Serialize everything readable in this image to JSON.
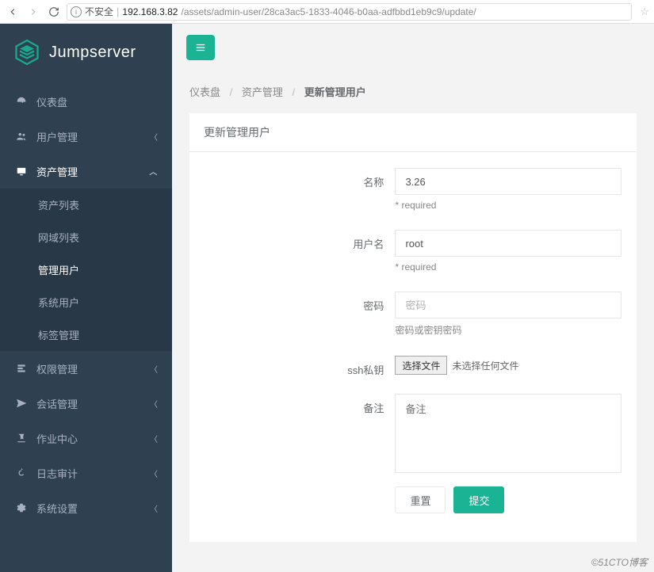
{
  "browser": {
    "insecure_label": "不安全",
    "host": "192.168.3.82",
    "path": "/assets/admin-user/28ca3ac5-1833-4046-b0aa-adfbbd1eb9c9/update/"
  },
  "brand": {
    "name": "Jumpserver"
  },
  "sidebar": {
    "items": [
      {
        "label": "仪表盘",
        "icon": "dashboard-icon",
        "expandable": false
      },
      {
        "label": "用户管理",
        "icon": "users-icon",
        "expandable": true
      },
      {
        "label": "资产管理",
        "icon": "assets-icon",
        "expandable": true,
        "open": true,
        "children": [
          {
            "label": "资产列表"
          },
          {
            "label": "网域列表"
          },
          {
            "label": "管理用户",
            "active": true
          },
          {
            "label": "系统用户"
          },
          {
            "label": "标签管理"
          }
        ]
      },
      {
        "label": "权限管理",
        "icon": "perms-icon",
        "expandable": true
      },
      {
        "label": "会话管理",
        "icon": "sessions-icon",
        "expandable": true
      },
      {
        "label": "作业中心",
        "icon": "jobs-icon",
        "expandable": true
      },
      {
        "label": "日志审计",
        "icon": "audit-icon",
        "expandable": true
      },
      {
        "label": "系统设置",
        "icon": "settings-icon",
        "expandable": true
      }
    ]
  },
  "breadcrumb": {
    "a": "仪表盘",
    "b": "资产管理",
    "c": "更新管理用户"
  },
  "panel": {
    "title": "更新管理用户"
  },
  "form": {
    "name": {
      "label": "名称",
      "value": "3.26",
      "hint": "* required"
    },
    "username": {
      "label": "用户名",
      "value": "root",
      "hint": "* required"
    },
    "password": {
      "label": "密码",
      "placeholder": "密码",
      "hint": "密码或密钥密码"
    },
    "sshkey": {
      "label": "ssh私钥",
      "button": "选择文件",
      "status": "未选择任何文件"
    },
    "note": {
      "label": "备注",
      "placeholder": "备注"
    },
    "reset": "重置",
    "submit": "提交"
  },
  "watermark": "51CTO博客"
}
